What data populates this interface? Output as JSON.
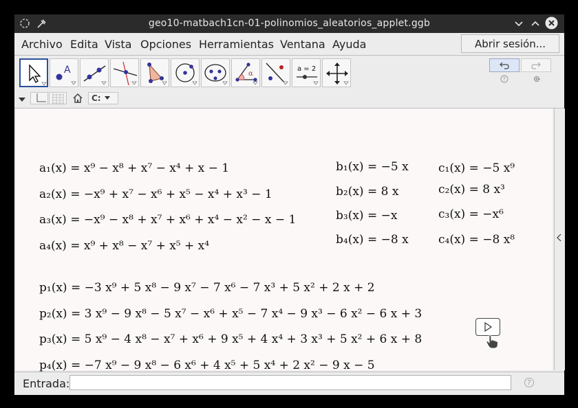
{
  "window": {
    "title": "geo10-matbach1cn-01-polinomios_aleatorios_applet.ggb",
    "controls": [
      "minimize-icon",
      "maximize-icon",
      "close-icon"
    ]
  },
  "menubar": {
    "items": [
      "Archivo",
      "Edita",
      "Vista",
      "Opciones",
      "Herramientas",
      "Ventana",
      "Ayuda"
    ],
    "login_label": "Abrir sesión..."
  },
  "toolbar": {
    "tools": [
      "move-tool-icon",
      "point-tool-icon",
      "line-tool-icon",
      "perpendicular-tool-icon",
      "polygon-tool-icon",
      "circle-tool-icon",
      "conic-tool-icon",
      "angle-tool-icon",
      "reflect-tool-icon",
      "slider-tool-icon",
      "move-view-tool-icon"
    ],
    "slider_tool_label": "a = 2",
    "undo_icon": "undo-icon",
    "redo_icon": "redo-icon"
  },
  "style_toolbar": {
    "items": [
      "axes-icon",
      "grid-icon",
      "home-icon",
      "point-capture-icon"
    ],
    "point_capture_label": "C:"
  },
  "formulas": {
    "a": [
      "a₁(x) = x⁹ − x⁸ + x⁷ − x⁴ + x − 1",
      "a₂(x) = −x⁹ + x⁷ − x⁶ + x⁵ − x⁴ + x³ − 1",
      "a₃(x) = −x⁹ − x⁸ + x⁷ + x⁶ + x⁴ − x² − x − 1",
      "a₄(x) = x⁹ + x⁸ − x⁷ + x⁵ + x⁴"
    ],
    "b": [
      "b₁(x) = −5 x",
      "b₂(x) = 8 x",
      "b₃(x) = −x",
      "b₄(x) = −8 x"
    ],
    "c": [
      "c₁(x) = −5 x⁹",
      "c₂(x) = 8 x³",
      "c₃(x) = −x⁶",
      "c₄(x) = −8 x⁸"
    ],
    "p": [
      "p₁(x) = −3 x⁹ + 5 x⁸ − 9 x⁷ − 7 x⁶ − 7 x³ + 5 x² + 2 x + 2",
      "p₂(x) = 3 x⁹ − 9 x⁸ − 5 x⁷ − x⁶ + x⁵ − 7 x⁴ − 9 x³ − 6 x² − 6 x + 3",
      "p₃(x) = 5 x⁹ − 4 x⁸ − x⁷ + x⁶ + 9 x⁵ + 4 x⁴ + 3 x³ + 5 x² + 6 x + 8",
      "p₄(x) = −7 x⁹ − 9 x⁸ − 6 x⁶ + 4 x⁵ + 5 x⁴ + 2 x² − 9 x − 5"
    ]
  },
  "input_bar": {
    "label": "Entrada:",
    "value": "",
    "placeholder": ""
  }
}
